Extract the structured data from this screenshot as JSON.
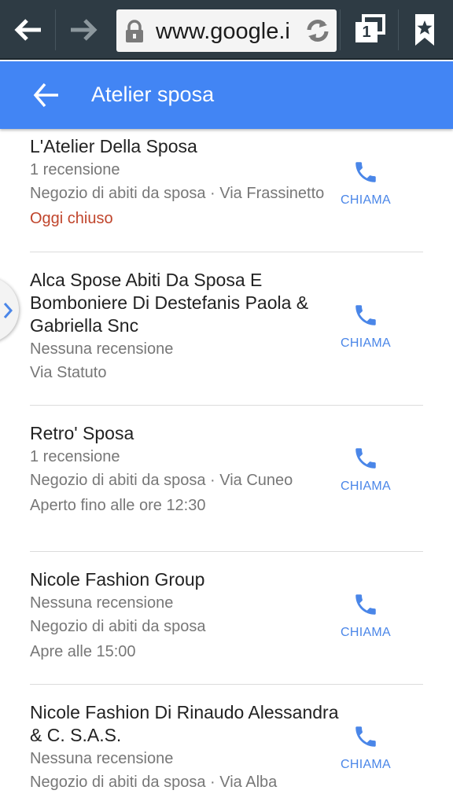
{
  "browser": {
    "url": "www.google.i",
    "tab_count": "1"
  },
  "header": {
    "title": "Atelier sposa"
  },
  "colors": {
    "header": "#4285f4",
    "accent": "#4a86e8",
    "closed": "#c0452c"
  },
  "results": [
    {
      "name": "L'Atelier Della Sposa",
      "reviews": "1 recensione",
      "details": "Negozio di abiti da sposa · Via Frassinetto",
      "hours": "Oggi chiuso",
      "call_label": "CHIAMA"
    },
    {
      "name": "Alca Spose Abiti Da Sposa E Bomboniere Di Destefanis Paola & Gabriella Snc",
      "reviews": "Nessuna recensione",
      "details": "Via Statuto",
      "call_label": "CHIAMA"
    },
    {
      "name": "Retro' Sposa",
      "reviews": "1 recensione",
      "details": "Negozio di abiti da sposa · Via Cuneo",
      "hours": "Aperto fino alle ore 12:30",
      "call_label": "CHIAMA"
    },
    {
      "name": "Nicole Fashion Group",
      "reviews": "Nessuna recensione",
      "details": "Negozio di abiti da sposa",
      "hours": "Apre alle 15:00",
      "call_label": "CHIAMA"
    },
    {
      "name": "Nicole Fashion Di Rinaudo Alessandra & C. S.A.S.",
      "reviews": "Nessuna recensione",
      "details": "Negozio di abiti da sposa · Via Alba",
      "call_label": "CHIAMA"
    }
  ]
}
